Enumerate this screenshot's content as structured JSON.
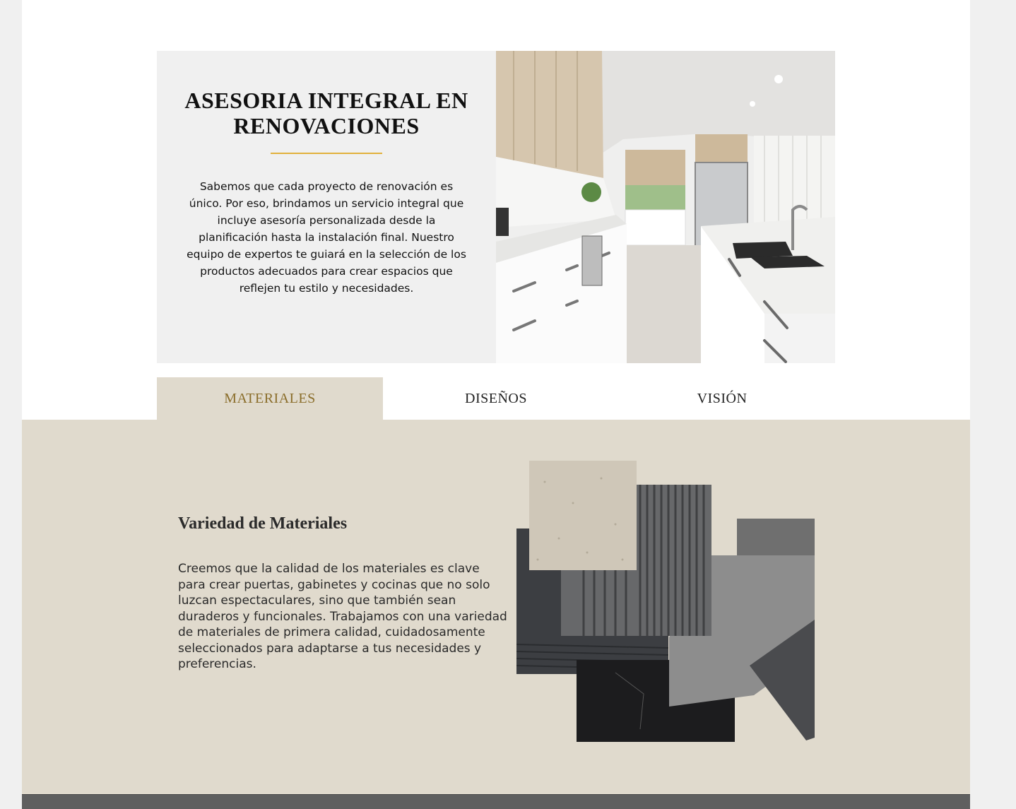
{
  "hero": {
    "title": "ASESORIA INTEGRAL EN RENOVACIONES",
    "text": "Sabemos que cada proyecto de renovación es único. Por eso, brindamos un servicio integral que incluye asesoría personalizada desde la planificación hasta la instalación final. Nuestro equipo de expertos te guiará en la selección de los productos adecuados para crear espacios que reflejen tu estilo y necesidades.",
    "accent_color": "#e2b13c"
  },
  "tabs": [
    {
      "label": "MATERIALES",
      "active": true
    },
    {
      "label": "DISEÑOS",
      "active": false
    },
    {
      "label": "VISIÓN",
      "active": false
    }
  ],
  "panel": {
    "heading": "Variedad de Materiales",
    "text": "Creemos que la calidad de los materiales es clave para crear puertas, gabinetes y cocinas que no solo luzcan espectaculares, sino que también sean duraderos y funcionales. Trabajamos con una variedad de materiales de primera calidad, cuidadosamente seleccionados para adaptarse a tus necesidades y preferencias.",
    "background": "#e0dacd"
  }
}
